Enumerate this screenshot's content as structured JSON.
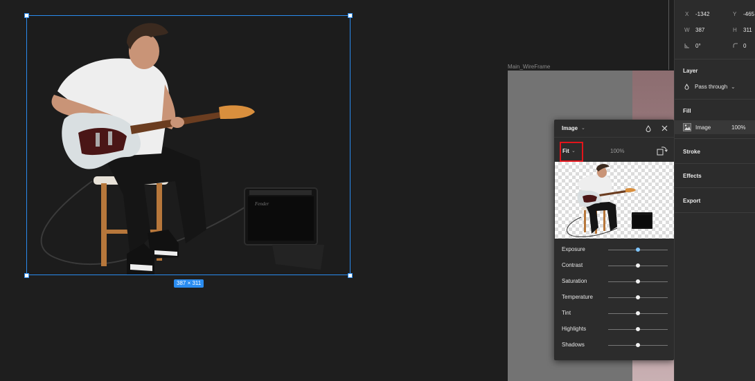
{
  "canvas": {
    "selection_size": "387 × 311",
    "frame_label": "Main_WireFrame"
  },
  "image_popover": {
    "title": "Image",
    "scale_mode": "Fit",
    "percent": "100%",
    "adjustments": [
      {
        "label": "Exposure",
        "value": 0.5
      },
      {
        "label": "Contrast",
        "value": 0.5
      },
      {
        "label": "Saturation",
        "value": 0.5
      },
      {
        "label": "Temperature",
        "value": 0.5
      },
      {
        "label": "Tint",
        "value": 0.5
      },
      {
        "label": "Highlights",
        "value": 0.5
      },
      {
        "label": "Shadows",
        "value": 0.5
      }
    ]
  },
  "properties": {
    "x_label": "X",
    "x_value": "-1342",
    "y_label": "Y",
    "y_value": "-465",
    "w_label": "W",
    "w_value": "387",
    "h_label": "H",
    "h_value": "311",
    "rotation_value": "0°",
    "radius_value": "0",
    "layer_title": "Layer",
    "blend_mode": "Pass through",
    "fill_title": "Fill",
    "fill_type": "Image",
    "fill_opacity": "100%",
    "stroke_title": "Stroke",
    "effects_title": "Effects",
    "export_title": "Export"
  },
  "colors": {
    "selection": "#2a8cf0",
    "highlight_box": "#e3141b",
    "canvas_bg": "#1e1e1e",
    "panel_bg": "#2c2c2c"
  }
}
